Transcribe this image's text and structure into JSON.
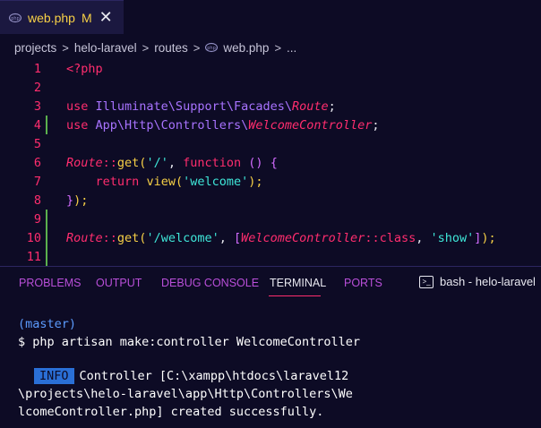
{
  "tab": {
    "filename": "web.php",
    "badge": "M",
    "close": "✕",
    "accent": "#f7d046"
  },
  "breadcrumb": {
    "items": [
      "projects",
      "helo-laravel",
      "routes",
      "web.php",
      "..."
    ]
  },
  "editor": {
    "lines": [
      {
        "num": "1",
        "changed": false
      },
      {
        "num": "2",
        "changed": false
      },
      {
        "num": "3",
        "changed": false
      },
      {
        "num": "4",
        "changed": true
      },
      {
        "num": "5",
        "changed": false
      },
      {
        "num": "6",
        "changed": false
      },
      {
        "num": "7",
        "changed": false
      },
      {
        "num": "8",
        "changed": false
      },
      {
        "num": "9",
        "changed": true
      },
      {
        "num": "10",
        "changed": true
      },
      {
        "num": "11",
        "changed": true
      }
    ],
    "code": {
      "l1_open": "<?php",
      "l3_use": "use",
      "l3_ns": "Illuminate\\Support\\Facades\\",
      "l3_cls": "Route",
      "l3_end": ";",
      "l4_use": "use",
      "l4_ns": "App\\Http\\Controllers\\",
      "l4_cls": "WelcomeController",
      "l4_end": ";",
      "l6_cls": "Route",
      "l6_op": "::",
      "l6_fn": "get",
      "l6_paren": "(",
      "l6_str": "'/'",
      "l6_comma": ",",
      "l6_kw": "function",
      "l6_args": "()",
      "l6_brace": "{",
      "l7_kw": "return",
      "l7_fn": "view",
      "l7_paren": "(",
      "l7_str": "'welcome'",
      "l7_close": ");",
      "l8_brace": "}",
      "l8_close": ");",
      "l10_cls": "Route",
      "l10_op": "::",
      "l10_fn": "get",
      "l10_paren": "(",
      "l10_str1": "'/welcome'",
      "l10_comma": ",",
      "l10_bracket": "[",
      "l10_cls2": "WelcomeController",
      "l10_op2": "::",
      "l10_kw": "class",
      "l10_comma2": ",",
      "l10_str2": "'show'",
      "l10_bracket2": "]",
      "l10_close": ");"
    }
  },
  "panel": {
    "tabs": [
      "PROBLEMS",
      "OUTPUT",
      "DEBUG CONSOLE",
      "TERMINAL",
      "PORTS"
    ],
    "active_tab": "TERMINAL",
    "shell_label": "bash - helo-laravel",
    "shell_more": "+"
  },
  "terminal": {
    "branch": "(master)",
    "command": "$ php artisan make:controller WelcomeController",
    "info_badge": "INFO",
    "out1": "Controller [C:\\xampp\\htdocs\\laravel12",
    "out2": "\\projects\\helo-laravel\\app\\Http\\Controllers\\We",
    "out3": "lcomeController.php] created successfully."
  }
}
